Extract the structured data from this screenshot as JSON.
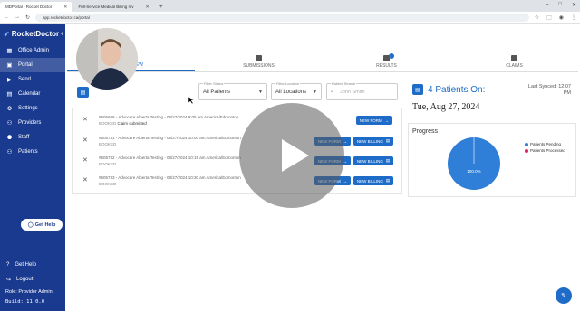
{
  "browser": {
    "tabs": [
      {
        "title": "MDPortal - Rocket Doctor",
        "active": true
      },
      {
        "title": "Full-Service Medical Billing Inv",
        "active": false
      }
    ],
    "url": "app.rocketdoctor.ca/portal"
  },
  "sidebar": {
    "brand": "RocketDoctor",
    "items": [
      {
        "label": "Office Admin",
        "icon": "building-icon"
      },
      {
        "label": "Portal",
        "icon": "portal-icon"
      },
      {
        "label": "Send",
        "icon": "send-icon"
      },
      {
        "label": "Calendar",
        "icon": "calendar-icon"
      },
      {
        "label": "Settings",
        "icon": "gear-icon"
      },
      {
        "label": "Providers",
        "icon": "providers-icon"
      },
      {
        "label": "Staff",
        "icon": "staff-icon"
      },
      {
        "label": "Patients",
        "icon": "patients-icon"
      }
    ],
    "get_help_button": "Get Help",
    "footer": [
      {
        "label": "Get Help",
        "icon": "help-icon"
      },
      {
        "label": "Logout",
        "icon": "logout-icon"
      }
    ],
    "role": "Role: Provider Admin",
    "build": "Build: 11.0.0"
  },
  "main": {
    "tabs": [
      {
        "label": "OVERVIEW",
        "active": true,
        "badge": ""
      },
      {
        "label": "SUBMISSIONS",
        "active": false,
        "badge": ""
      },
      {
        "label": "RESULTS",
        "active": false,
        "badge": "1"
      },
      {
        "label": "CLAIMS",
        "active": false,
        "badge": ""
      }
    ],
    "filters": {
      "status": {
        "label": "Filter Status",
        "value": "All Patients"
      },
      "location": {
        "label": "Filter Location",
        "value": "All Locations"
      },
      "search": {
        "label": "Patient Search",
        "placeholder": "John Smith"
      }
    },
    "rows": [
      {
        "line1": "#505688 - Advocare Alberta Testing - 08/27/2024 9:05 am America/Edmonton",
        "status": "BOOKED",
        "note": "Claim submitted",
        "buttons": [
          "NEW FORM"
        ]
      },
      {
        "line1": "#505731 - Advocare Alberta Testing - 08/27/2024 10:00 am America/Edmonton",
        "status": "BOOKED",
        "note": "",
        "buttons": [
          "NEW FORM",
          "NEW BILLING"
        ]
      },
      {
        "line1": "#505732 - Advocare Alberta Testing - 08/27/2024 10:15 am America/Edmonton",
        "status": "BOOKED",
        "note": "",
        "buttons": [
          "NEW FORM",
          "NEW BILLING"
        ]
      },
      {
        "line1": "#505733 - Advocare Alberta Testing - 08/27/2024 10:30 am America/Edmonton",
        "status": "BOOKED",
        "note": "",
        "buttons": [
          "NEW FORM",
          "NEW BILLING"
        ]
      }
    ]
  },
  "right_panel": {
    "title": "4 Patients On:",
    "date": "Tue, Aug 27, 2024",
    "last_synced": "Last Synced: 12:07 PM",
    "progress_title": "Progress"
  },
  "chart_data": {
    "type": "pie",
    "categories": [
      "Patients Pending",
      "Patients Processed"
    ],
    "values": [
      100,
      0
    ],
    "data_label": "100.0%",
    "legend": "right",
    "colors": [
      "#2f7ed8",
      "#e0245e"
    ]
  }
}
